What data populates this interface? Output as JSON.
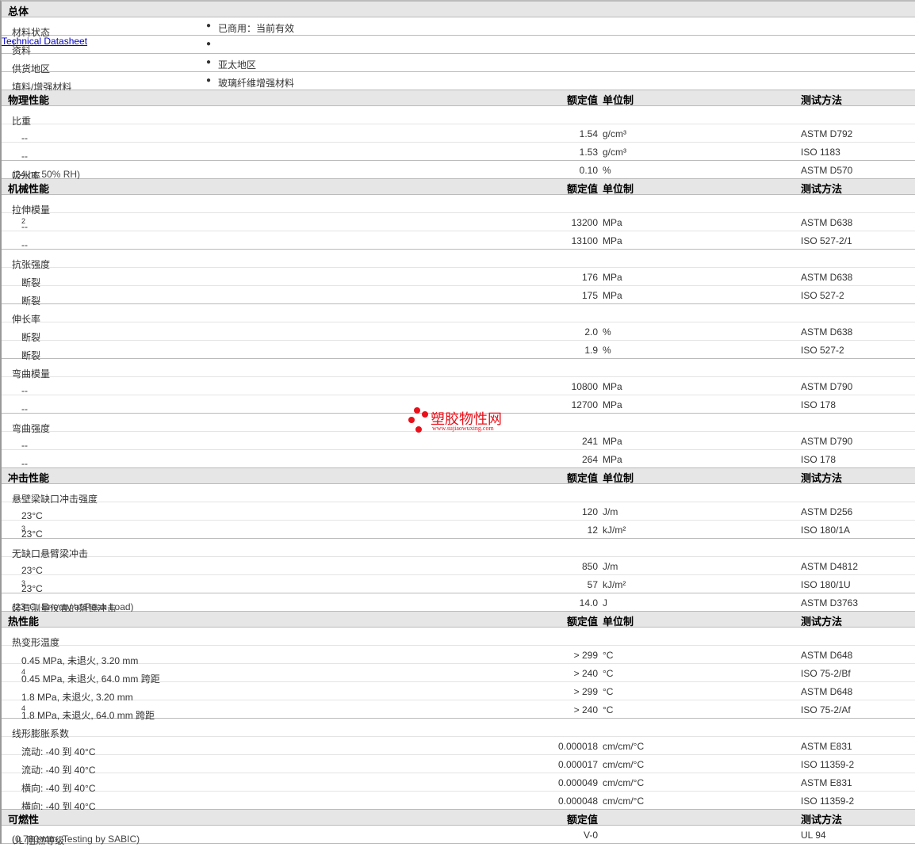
{
  "general": {
    "title": "总体",
    "rows": [
      {
        "label": "材料状态",
        "value": "已商用：当前有效"
      },
      {
        "label": "资料",
        "sup": "1",
        "value": "Technical Datasheet",
        "link": true
      },
      {
        "label": "供货地区",
        "value": "亚太地区"
      },
      {
        "label": "填料/增强材料",
        "value": "玻璃纤维增强材料"
      }
    ]
  },
  "sections": [
    {
      "title": "物理性能",
      "h_value": "额定值",
      "h_unit": "单位制",
      "h_method": "测试方法",
      "groups": [
        {
          "label": "比重",
          "rows": [
            {
              "label": "--",
              "value": "1.54",
              "unit": "g/cm³",
              "method": "ASTM D792"
            },
            {
              "label": "--",
              "value": "1.53",
              "unit": "g/cm³",
              "method": "ISO 1183"
            }
          ]
        },
        {
          "label": "吸水率",
          "note": "(24 hr, 50% RH)",
          "value": "0.10",
          "unit": "%",
          "method": "ASTM D570"
        }
      ]
    },
    {
      "title": "机械性能",
      "h_value": "额定值",
      "h_unit": "单位制",
      "h_method": "测试方法",
      "groups": [
        {
          "label": "拉伸模量",
          "rows": [
            {
              "label": "--",
              "sup": "2",
              "value": "13200",
              "unit": "MPa",
              "method": "ASTM D638"
            },
            {
              "label": "--",
              "value": "13100",
              "unit": "MPa",
              "method": "ISO 527-2/1"
            }
          ]
        },
        {
          "label": "抗张强度",
          "rows": [
            {
              "label": "断裂",
              "value": "176",
              "unit": "MPa",
              "method": "ASTM D638"
            },
            {
              "label": "断裂",
              "value": "175",
              "unit": "MPa",
              "method": "ISO 527-2"
            }
          ]
        },
        {
          "label": "伸长率",
          "rows": [
            {
              "label": "断裂",
              "value": "2.0",
              "unit": "%",
              "method": "ASTM D638"
            },
            {
              "label": "断裂",
              "value": "1.9",
              "unit": "%",
              "method": "ISO 527-2"
            }
          ]
        },
        {
          "label": "弯曲模量",
          "rows": [
            {
              "label": "--",
              "value": "10800",
              "unit": "MPa",
              "method": "ASTM D790"
            },
            {
              "label": "--",
              "value": "12700",
              "unit": "MPa",
              "method": "ISO 178"
            }
          ]
        },
        {
          "label": "弯曲强度",
          "rows": [
            {
              "label": "--",
              "value": "241",
              "unit": "MPa",
              "method": "ASTM D790"
            },
            {
              "label": "--",
              "value": "264",
              "unit": "MPa",
              "method": "ISO 178"
            }
          ]
        }
      ]
    },
    {
      "title": "冲击性能",
      "h_value": "额定值",
      "h_unit": "单位制",
      "h_method": "测试方法",
      "groups": [
        {
          "label": "悬壁梁缺口冲击强度",
          "rows": [
            {
              "label": "23°C",
              "value": "120",
              "unit": "J/m",
              "method": "ASTM D256"
            },
            {
              "label": "23°C",
              "sup": "3",
              "value": "12",
              "unit": "kJ/m²",
              "method": "ISO 180/1A"
            }
          ]
        },
        {
          "label": "无缺口悬臂梁冲击",
          "rows": [
            {
              "label": "23°C",
              "value": "850",
              "unit": "J/m",
              "method": "ASTM D4812"
            },
            {
              "label": "23°C",
              "sup": "3",
              "value": "57",
              "unit": "kJ/m²",
              "method": "ISO 180/1U"
            }
          ]
        },
        {
          "label": "装有测量仪表的落镖冲击",
          "note": "(23°C, Energy at Peak Load)",
          "value": "14.0",
          "unit": "J",
          "method": "ASTM D3763"
        }
      ]
    },
    {
      "title": "热性能",
      "h_value": "额定值",
      "h_unit": "单位制",
      "h_method": "测试方法",
      "groups": [
        {
          "label": "热变形温度",
          "rows": [
            {
              "label": "0.45 MPa, 未退火, 3.20 mm",
              "value": "> 299",
              "unit": "°C",
              "method": "ASTM D648"
            },
            {
              "label": "0.45 MPa, 未退火, 64.0 mm 跨距",
              "sup": "4",
              "value": "> 240",
              "unit": "°C",
              "method": "ISO 75-2/Bf"
            },
            {
              "label": "1.8 MPa, 未退火, 3.20 mm",
              "value": "> 299",
              "unit": "°C",
              "method": "ASTM D648"
            },
            {
              "label": "1.8 MPa, 未退火, 64.0 mm 跨距",
              "sup": "4",
              "value": "> 240",
              "unit": "°C",
              "method": "ISO 75-2/Af"
            }
          ]
        },
        {
          "label": "线形膨胀系数",
          "rows": [
            {
              "label": "流动: -40 到  40°C",
              "value": "0.000018",
              "unit": "cm/cm/°C",
              "method": "ASTM E831"
            },
            {
              "label": "流动: -40 到  40°C",
              "value": "0.000017",
              "unit": "cm/cm/°C",
              "method": "ISO 11359-2"
            },
            {
              "label": "横向: -40 到  40°C",
              "value": "0.000049",
              "unit": "cm/cm/°C",
              "method": "ASTM E831"
            },
            {
              "label": "横向: -40 到  40°C",
              "value": "0.000048",
              "unit": "cm/cm/°C",
              "method": "ISO 11359-2"
            }
          ]
        }
      ]
    },
    {
      "title": "可燃性",
      "h_value": "额定值",
      "h_unit": "",
      "h_method": "测试方法",
      "groups": [
        {
          "label": "UL 阻燃等级",
          "note": "(0.780 mm, Testing by SABIC)",
          "value": "V-0",
          "unit": "",
          "method": "UL 94"
        }
      ]
    }
  ],
  "watermark": {
    "name": "塑胶物性网",
    "url": "www.sujiaowuxing.com"
  },
  "colors": {
    "header_bg": "#e6e6e6",
    "link": "#0000cc",
    "logo": "#e8101a"
  }
}
